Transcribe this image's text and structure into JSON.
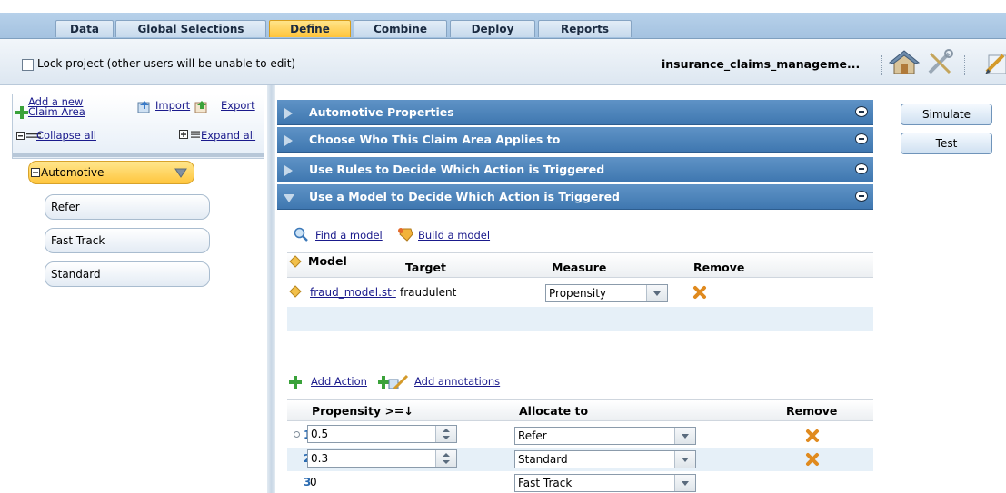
{
  "tabs": [
    {
      "label": "Data",
      "active": false
    },
    {
      "label": "Global Selections",
      "active": false
    },
    {
      "label": "Define",
      "active": true
    },
    {
      "label": "Combine",
      "active": false
    },
    {
      "label": "Deploy",
      "active": false
    },
    {
      "label": "Reports",
      "active": false
    }
  ],
  "toolbar": {
    "lock_label": "Lock project (other users will be unable to edit)",
    "project_name": "insurance_claims_manageme...",
    "icons": [
      "home-icon",
      "tools-icon",
      "edit-icon"
    ]
  },
  "left_panel": {
    "add_claim_area": "Add a new Claim Area",
    "add_line1": "Add a new",
    "add_line2": "Claim Area",
    "import": "Import",
    "export": "Export",
    "collapse_all": "Collapse all",
    "expand_all": "Expand all",
    "tree": {
      "root": "Automotive",
      "children": [
        "Refer",
        "Fast Track",
        "Standard"
      ]
    }
  },
  "accordion": [
    {
      "label": "Automotive Properties",
      "expanded": false
    },
    {
      "label": "Choose Who This Claim Area Applies to",
      "expanded": false
    },
    {
      "label": "Use Rules to Decide Which Action is Triggered",
      "expanded": false
    },
    {
      "label": "Use a Model to Decide Which Action is Triggered",
      "expanded": true
    }
  ],
  "side_buttons": {
    "simulate": "Simulate",
    "test": "Test"
  },
  "model_section": {
    "find_model": "Find a model",
    "build_model": "Build a model",
    "headers": {
      "model": "Model",
      "target": "Target",
      "measure": "Measure",
      "remove": "Remove"
    },
    "rows": [
      {
        "model": "fraud_model.str",
        "target": "fraudulent",
        "measure": "Propensity"
      }
    ]
  },
  "action_section": {
    "add_action": "Add Action",
    "add_annotations": "Add annotations",
    "headers": {
      "propensity": "Propensity >=↓",
      "allocate": "Allocate to",
      "remove": "Remove"
    },
    "rows": [
      {
        "num": "1",
        "propensity": "0.5",
        "allocate": "Refer",
        "removable": true
      },
      {
        "num": "2",
        "propensity": "0.3",
        "allocate": "Standard",
        "removable": true
      },
      {
        "num": "3",
        "propensity": "0",
        "allocate": "Fast Track",
        "removable": false
      }
    ]
  },
  "colors": {
    "tab_bar": "#a4c2e0",
    "tab_active": "#ffc43a",
    "accordion": "#3f77b0",
    "link": "#1a1a8c",
    "row_alt": "#e6f0f8",
    "remove_icon": "#e08a1e"
  }
}
